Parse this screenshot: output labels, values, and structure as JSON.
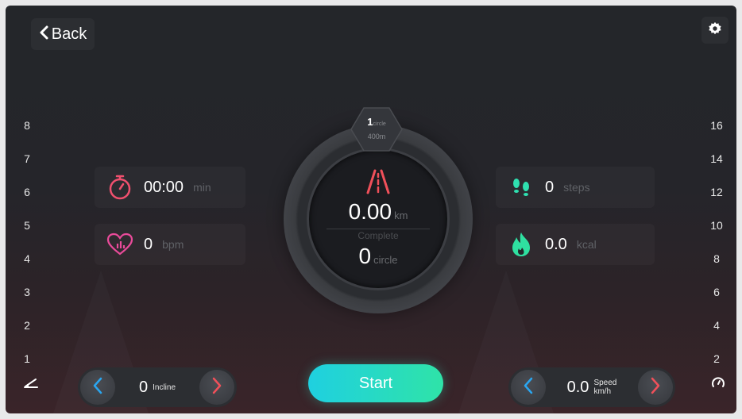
{
  "header": {
    "back_label": "Back"
  },
  "incline_scale": [
    "8",
    "7",
    "6",
    "5",
    "4",
    "3",
    "2",
    "1"
  ],
  "speed_scale": [
    "16",
    "14",
    "12",
    "10",
    "8",
    "6",
    "4",
    "2"
  ],
  "ring": {
    "lap_count": "1",
    "lap_unit": "circle",
    "lap_length": "400m",
    "distance_value": "0.00",
    "distance_unit": "km",
    "complete_label": "Complete",
    "circle_value": "0",
    "circle_unit": "circle"
  },
  "stats": {
    "time": {
      "value": "00:00",
      "unit": "min",
      "icon": "stopwatch-icon",
      "color": "#f0506e"
    },
    "heart": {
      "value": "0",
      "unit": "bpm",
      "icon": "heart-rate-icon",
      "color": "#e94b9a"
    },
    "steps": {
      "value": "0",
      "unit": "steps",
      "icon": "footprints-icon",
      "color": "#2fe0b0"
    },
    "calories": {
      "value": "0.0",
      "unit": "kcal",
      "icon": "flame-icon",
      "color": "#2fe0a0"
    }
  },
  "incline_control": {
    "value": "0",
    "label": "Incline"
  },
  "speed_control": {
    "value": "0.0",
    "label_line1": "Speed",
    "label_line2": "km/h"
  },
  "start_label": "Start",
  "colors": {
    "accent_blue": "#2aa6f0",
    "accent_red": "#f0505a",
    "start_from": "#1fd0e0",
    "start_to": "#2fe3a8"
  }
}
